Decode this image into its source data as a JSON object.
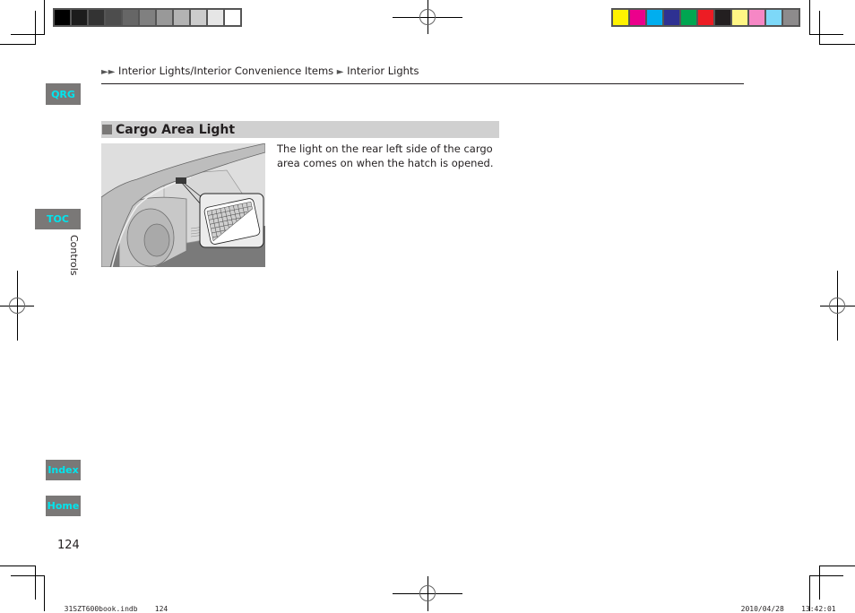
{
  "breadcrumb": {
    "arrows": "►►",
    "parent": "Interior Lights/Interior Convenience Items",
    "separator": "►",
    "current": "Interior Lights"
  },
  "nav": {
    "qrg": "QRG",
    "toc": "TOC",
    "index": "Index",
    "home": "Home",
    "section_label": "Controls",
    "accent_color": "#00e5ee",
    "tab_color": "#7a7877"
  },
  "section": {
    "title": "Cargo Area Light",
    "body": "The light on the rear left side of the cargo area comes on when the hatch is opened.",
    "figure_alt": "Cargo area with rear left light highlighted in callout"
  },
  "page_number": "124",
  "slug": {
    "file": "31SZT600book.indb",
    "page": "124",
    "date": "2010/04/28",
    "time": "13:42:01"
  },
  "color_bars": {
    "grayscale": [
      "#000000",
      "#1c1c1c",
      "#333333",
      "#4d4d4d",
      "#666666",
      "#808080",
      "#999999",
      "#b3b3b3",
      "#cccccc",
      "#e6e6e6",
      "#ffffff"
    ],
    "process": [
      "#fff200",
      "#ec008c",
      "#00aeef",
      "#2e3192",
      "#00a651",
      "#ed1c24",
      "#231f20",
      "#fff685",
      "#f687c5",
      "#7dd8f8",
      "#8d8b8c"
    ]
  }
}
